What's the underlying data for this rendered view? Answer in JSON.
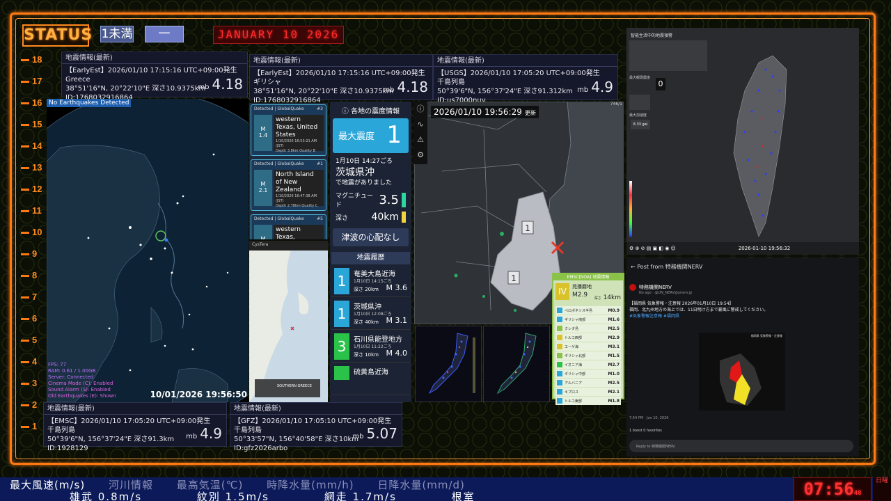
{
  "header": {
    "status_label": "STATUS",
    "tag_a": "1未満",
    "tag_b": "一",
    "date_led": "JANUARY 10 2026"
  },
  "scale": [
    "18",
    "17",
    "16",
    "15",
    "14",
    "13",
    "12",
    "11",
    "10",
    "9",
    "8",
    "7",
    "6",
    "5",
    "4",
    "3",
    "2",
    "1"
  ],
  "info_boxes": [
    {
      "header": "地震情報(最新)",
      "line1": "【EarlyEst】2026/01/10  17:15:16  UTC+09:00発生",
      "line2": "Greece",
      "line3": "38°51'16\"N, 20°22'10\"E  深さ10.9375km",
      "line4": "ID:1768032916864",
      "mag_unit": "mb",
      "mag": "4.18"
    },
    {
      "header": "地震情報(最新)",
      "line1": "【EarlyEst】2026/01/10  17:15:16  UTC+09:00発生",
      "line2": "ギリシャ",
      "line3": "38°51'16\"N, 20°22'10\"E  深さ10.9375km",
      "line4": "ID:1768032916864",
      "mag_unit": "mb",
      "mag": "4.18"
    },
    {
      "header": "地震情報(最新)",
      "line1": "【USGS】2026/01/10  17:05:20  UTC+09:00発生",
      "line2": "千島列島",
      "line3": "50°39'6\"N, 156°37'24\"E  深さ91.312km",
      "line4": "ID:us7000nuy",
      "mag_unit": "mb",
      "mag": "4.9"
    },
    {
      "header": "地震情報(最新)",
      "line1": "【EMSC】2026/01/10  17:05:20  UTC+09:00発生",
      "line2": "千島列島",
      "line3": "50°39'6\"N, 156°37'24\"E  深さ91.3km",
      "line4": "ID:1928129",
      "mag_unit": "mb",
      "mag": "4.9"
    },
    {
      "header": "地震情報(最新)",
      "line1": "【GFZ】2026/01/10  17:05:10  UTC+09:00発生",
      "line2": "千島列島",
      "line3": "50°33'57\"N, 156°40'58\"E  深さ10km",
      "line4": "ID:gfz2026arbo",
      "mag_unit": "mb",
      "mag": "5.07"
    }
  ],
  "globe": {
    "no_detect": "No Earthquakes Detected",
    "timestamp": "10/01/2026 19:56:50",
    "stats": [
      "FPS: 77",
      "RAM: 0.61 / 1.00GB",
      "Server: Connected",
      "Cinema Mode (C): Enabled",
      "Sound Alarm (S): Enabled",
      "Old Earthquakes (E): Shown"
    ]
  },
  "quake_list": [
    {
      "hdr": "Detected | GlobalQuake",
      "num": "#3",
      "mag": "1.4",
      "name": "western Texas, United States",
      "dt": "1/10/2026 16:53:21 AM (JST)",
      "q": "Depth 3.8km    Quality B"
    },
    {
      "hdr": "Detected | GlobalQuake",
      "num": "#1",
      "mag": "2.1",
      "name": "North Island of New Zealand",
      "dt": "1/10/2026 16:47:38 AM (JST)",
      "q": "Depth 2.78km    Quality C"
    },
    {
      "hdr": "Detected | GlobalQuake",
      "num": "#5",
      "mag": "",
      "name": "western Texas,",
      "dt": "",
      "q": ""
    }
  ],
  "phone": {
    "bar": "CysTera",
    "label": "SOUTHERN GREECE"
  },
  "jma": {
    "title": "ⓘ 各地の震度情報",
    "max_label": "最大震度",
    "max_value": "1",
    "time": "1月10日 14:27ごろ",
    "pref": "茨城県沖",
    "note": "で地震がありました",
    "mag_label": "マグニチュード",
    "mag_value": "3.5",
    "depth_label": "深さ",
    "depth_value": "40km",
    "tsunami": "津波の心配なし",
    "history_title": "地震履歴",
    "history": [
      {
        "int": "1",
        "place": "奄美大島近海",
        "time": "1月10日 14:15ごろ",
        "depth": "深さ 20km",
        "mag": "M 3.6"
      },
      {
        "int": "1",
        "place": "茨城県沖",
        "time": "1月10日 12:08ごろ",
        "depth": "深さ 40km",
        "mag": "M 3.1"
      },
      {
        "int": "3",
        "place": "石川県能登地方",
        "time": "1月10日 11:22ごろ",
        "depth": "深さ 10km",
        "mag": "M 4.0"
      },
      {
        "int": "",
        "place": "硫黄島近海",
        "time": "",
        "depth": "",
        "mag": ""
      }
    ]
  },
  "map_main": {
    "updated": "2026/01/10 19:56:29",
    "upd_label": "更新",
    "corner": "746/1",
    "intensity_1": "1",
    "intensity_2": "1"
  },
  "emsc": {
    "title": "EMSC[NOA] 地震情報",
    "int": "IV",
    "place": "苑播磨地",
    "mag": "M2.9",
    "depth_label": "深さ",
    "depth": "14km",
    "rows": [
      {
        "n": "ペロポネソス半島",
        "v": "M0.9"
      },
      {
        "n": "ギリシャ南部",
        "v": "M1.6"
      },
      {
        "n": "クレタ島",
        "v": "M2.5"
      },
      {
        "n": "トルコ西部",
        "v": "M2.9"
      },
      {
        "n": "エーゲ海",
        "v": "M3.1"
      },
      {
        "n": "ギリシャ北部",
        "v": "M1.5"
      },
      {
        "n": "イオニア海",
        "v": "M2.7"
      },
      {
        "n": "ギリシャ中部",
        "v": "M1.0"
      },
      {
        "n": "アルバニア",
        "v": "M2.5"
      },
      {
        "n": "キプロス",
        "v": "M2.1"
      },
      {
        "n": "トルコ東部",
        "v": "M1.8"
      }
    ]
  },
  "tw_panel": {
    "title": "智能生活中的地震預警",
    "zero": "0",
    "toolbar_time": "2026-01-10 19:56:32",
    "labels": [
      "最大觀測震度",
      "最大加速度",
      "6.33 gal"
    ]
  },
  "post": {
    "header": "Post from 特務機関NERV",
    "name": "特務機関NERV",
    "handle": "No ago · @UN_NERV@unerv.jp",
    "body": "【福岡県 気象警報・注意報 2026年01月10日 19:54】",
    "body2": "福岡、北九州地方の海上では、11日明け方まで暴風に警戒してください。",
    "tags": "#気象警報注意報 #福岡県",
    "image_title": "福岡県 気象警報・注意報",
    "time": "7:54 PM · Jan 10, 2026",
    "boosts": "1 boost   0 favorites",
    "reply": "Reply to 特務機関NERV"
  },
  "ticker": {
    "line1": [
      "最大風速(m/s)",
      "河川情報",
      "最高気温(℃)",
      "時降水量(mm/h)",
      "日降水量(mm/d)"
    ],
    "line2": [
      "雄武 0.8m/s",
      "紋別 1.5m/s",
      "網走 1.7m/s",
      "根室"
    ]
  },
  "clock": {
    "time": "07:56",
    "sec": "48",
    "side": "日曜"
  }
}
